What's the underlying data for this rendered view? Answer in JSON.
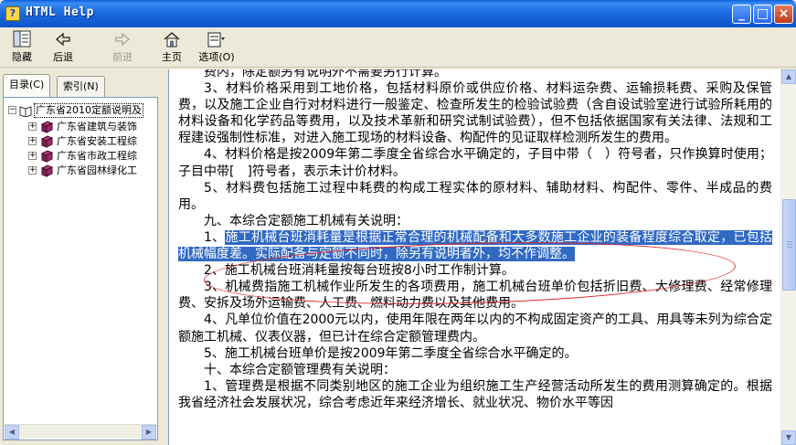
{
  "window": {
    "title": "HTML Help"
  },
  "toolbar": {
    "hide": "隐藏",
    "back": "后退",
    "forward": "前进",
    "home": "主页",
    "options": "选项(O)"
  },
  "tabs": {
    "contents": "目录(C)",
    "index": "索引(N)"
  },
  "tree": {
    "root": "广东省2010定额说明及",
    "items": [
      "广东省建筑与装饰",
      "广东省安装工程综",
      "广东省市政工程综",
      "广东省园林绿化工"
    ]
  },
  "content": {
    "line0": "费内，除定额另有说明外不需要另行计算。",
    "para3": "3、材料价格采用到工地价格，包括材料原价或供应价格、材料运杂费、运输损耗费、采购及保管费，以及施工企业自行对材料进行一般鉴定、检查所发生的检验试验费（含自设试验室进行试验所耗用的材料设备和化学药品等费用，以及技术革新和研究试制试验费），但不包括依据国家有关法律、法规和工程建设强制性标准，对进入施工现场的材料设备、构配件的见证取样检测所发生的费用。",
    "para4": "4、材料价格是按2009年第二季度全省综合水平确定的，子目中带（　）符号者，只作换算时使用；子目中带[　]符号者，表示未计价材料。",
    "para5": "5、材料费包括施工过程中耗费的构成工程实体的原材料、辅助材料、构配件、零件、半成品的费用。",
    "heading9": "九、本综合定额施工机械有关说明：",
    "m1_prefix": "1、",
    "m1_highlight": "施工机械台班消耗量是根据正常合理的机械配备和大多数施工企业的装备程度综合取定，已包括机械幅度差。实际配备与定额不同时，除另有说明者外，均不作调整。",
    "m2": "2、施工机械台班消耗量按每台班按8小时工作制计算。",
    "m3": "3、机械费指施工机械作业所发生的各项费用，施工机械台班单价包括折旧费、大修理费、经常修理费、安拆及场外运输费、人工费、燃料动力费以及其他费用。",
    "m4": "4、凡单位价值在2000元以内，使用年限在两年以内的不构成固定资产的工具、用具等未列为综合定额施工机械、仪表仪器，但已计在综合定额管理费内。",
    "m5": "5、施工机械台班单价是按2009年第二季度全省综合水平确定的。",
    "heading10": "十、本综合定额管理费有关说明：",
    "g1": "1、管理费是根据不同类别地区的施工企业为组织施工生产经营活动所发生的费用测算确定的。根据我省经济社会发展状况，综合考虑近年来经济增长、就业状况、物价水平等因"
  },
  "colors": {
    "title_bar": "#0d55cc",
    "highlight": "#316ac5",
    "annotation": "#e02a2a"
  }
}
